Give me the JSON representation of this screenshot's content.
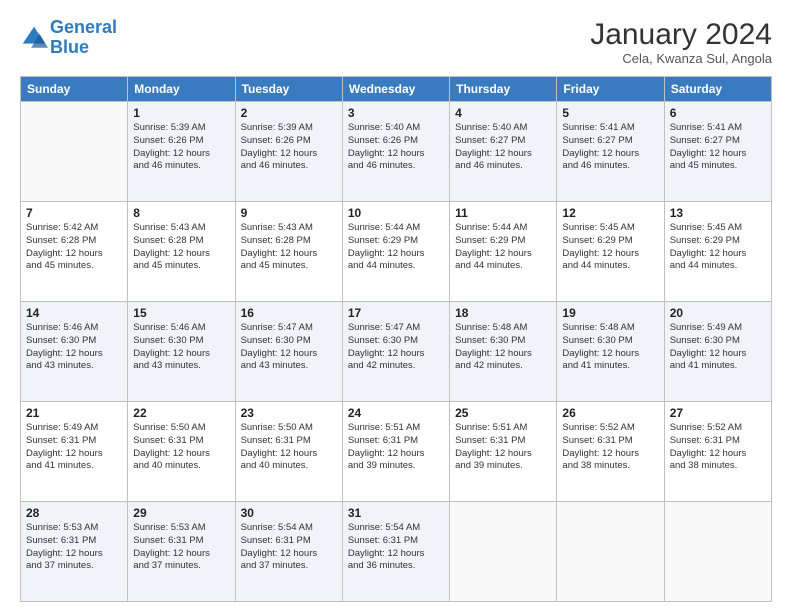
{
  "logo": {
    "line1": "General",
    "line2": "Blue"
  },
  "title": "January 2024",
  "subtitle": "Cela, Kwanza Sul, Angola",
  "days_of_week": [
    "Sunday",
    "Monday",
    "Tuesday",
    "Wednesday",
    "Thursday",
    "Friday",
    "Saturday"
  ],
  "weeks": [
    [
      {
        "day": "",
        "info": ""
      },
      {
        "day": "1",
        "info": "Sunrise: 5:39 AM\nSunset: 6:26 PM\nDaylight: 12 hours\nand 46 minutes."
      },
      {
        "day": "2",
        "info": "Sunrise: 5:39 AM\nSunset: 6:26 PM\nDaylight: 12 hours\nand 46 minutes."
      },
      {
        "day": "3",
        "info": "Sunrise: 5:40 AM\nSunset: 6:26 PM\nDaylight: 12 hours\nand 46 minutes."
      },
      {
        "day": "4",
        "info": "Sunrise: 5:40 AM\nSunset: 6:27 PM\nDaylight: 12 hours\nand 46 minutes."
      },
      {
        "day": "5",
        "info": "Sunrise: 5:41 AM\nSunset: 6:27 PM\nDaylight: 12 hours\nand 46 minutes."
      },
      {
        "day": "6",
        "info": "Sunrise: 5:41 AM\nSunset: 6:27 PM\nDaylight: 12 hours\nand 45 minutes."
      }
    ],
    [
      {
        "day": "7",
        "info": "Sunrise: 5:42 AM\nSunset: 6:28 PM\nDaylight: 12 hours\nand 45 minutes."
      },
      {
        "day": "8",
        "info": "Sunrise: 5:43 AM\nSunset: 6:28 PM\nDaylight: 12 hours\nand 45 minutes."
      },
      {
        "day": "9",
        "info": "Sunrise: 5:43 AM\nSunset: 6:28 PM\nDaylight: 12 hours\nand 45 minutes."
      },
      {
        "day": "10",
        "info": "Sunrise: 5:44 AM\nSunset: 6:29 PM\nDaylight: 12 hours\nand 44 minutes."
      },
      {
        "day": "11",
        "info": "Sunrise: 5:44 AM\nSunset: 6:29 PM\nDaylight: 12 hours\nand 44 minutes."
      },
      {
        "day": "12",
        "info": "Sunrise: 5:45 AM\nSunset: 6:29 PM\nDaylight: 12 hours\nand 44 minutes."
      },
      {
        "day": "13",
        "info": "Sunrise: 5:45 AM\nSunset: 6:29 PM\nDaylight: 12 hours\nand 44 minutes."
      }
    ],
    [
      {
        "day": "14",
        "info": "Sunrise: 5:46 AM\nSunset: 6:30 PM\nDaylight: 12 hours\nand 43 minutes."
      },
      {
        "day": "15",
        "info": "Sunrise: 5:46 AM\nSunset: 6:30 PM\nDaylight: 12 hours\nand 43 minutes."
      },
      {
        "day": "16",
        "info": "Sunrise: 5:47 AM\nSunset: 6:30 PM\nDaylight: 12 hours\nand 43 minutes."
      },
      {
        "day": "17",
        "info": "Sunrise: 5:47 AM\nSunset: 6:30 PM\nDaylight: 12 hours\nand 42 minutes."
      },
      {
        "day": "18",
        "info": "Sunrise: 5:48 AM\nSunset: 6:30 PM\nDaylight: 12 hours\nand 42 minutes."
      },
      {
        "day": "19",
        "info": "Sunrise: 5:48 AM\nSunset: 6:30 PM\nDaylight: 12 hours\nand 41 minutes."
      },
      {
        "day": "20",
        "info": "Sunrise: 5:49 AM\nSunset: 6:30 PM\nDaylight: 12 hours\nand 41 minutes."
      }
    ],
    [
      {
        "day": "21",
        "info": "Sunrise: 5:49 AM\nSunset: 6:31 PM\nDaylight: 12 hours\nand 41 minutes."
      },
      {
        "day": "22",
        "info": "Sunrise: 5:50 AM\nSunset: 6:31 PM\nDaylight: 12 hours\nand 40 minutes."
      },
      {
        "day": "23",
        "info": "Sunrise: 5:50 AM\nSunset: 6:31 PM\nDaylight: 12 hours\nand 40 minutes."
      },
      {
        "day": "24",
        "info": "Sunrise: 5:51 AM\nSunset: 6:31 PM\nDaylight: 12 hours\nand 39 minutes."
      },
      {
        "day": "25",
        "info": "Sunrise: 5:51 AM\nSunset: 6:31 PM\nDaylight: 12 hours\nand 39 minutes."
      },
      {
        "day": "26",
        "info": "Sunrise: 5:52 AM\nSunset: 6:31 PM\nDaylight: 12 hours\nand 38 minutes."
      },
      {
        "day": "27",
        "info": "Sunrise: 5:52 AM\nSunset: 6:31 PM\nDaylight: 12 hours\nand 38 minutes."
      }
    ],
    [
      {
        "day": "28",
        "info": "Sunrise: 5:53 AM\nSunset: 6:31 PM\nDaylight: 12 hours\nand 37 minutes."
      },
      {
        "day": "29",
        "info": "Sunrise: 5:53 AM\nSunset: 6:31 PM\nDaylight: 12 hours\nand 37 minutes."
      },
      {
        "day": "30",
        "info": "Sunrise: 5:54 AM\nSunset: 6:31 PM\nDaylight: 12 hours\nand 37 minutes."
      },
      {
        "day": "31",
        "info": "Sunrise: 5:54 AM\nSunset: 6:31 PM\nDaylight: 12 hours\nand 36 minutes."
      },
      {
        "day": "",
        "info": ""
      },
      {
        "day": "",
        "info": ""
      },
      {
        "day": "",
        "info": ""
      }
    ]
  ]
}
